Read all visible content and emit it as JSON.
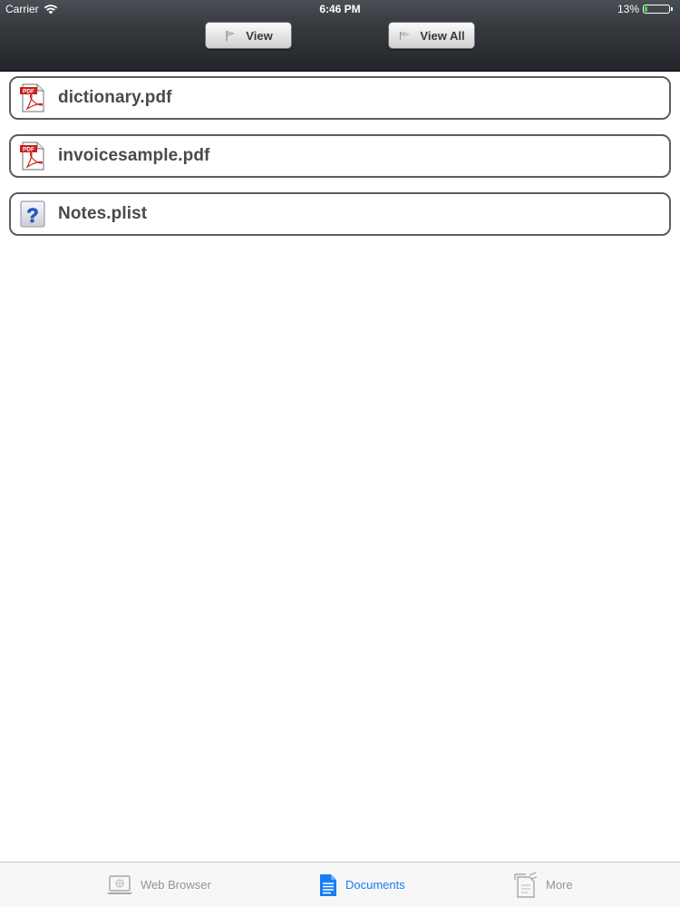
{
  "status_bar": {
    "carrier": "Carrier",
    "time": "6:46 PM",
    "battery_percent_label": "13%",
    "battery_level": 0.13,
    "wifi_icon": "wifi-icon",
    "battery_icon": "battery-icon"
  },
  "toolbar": {
    "view_label": "View",
    "view_all_label": "View All",
    "view_icon": "flag-icon",
    "view_all_icon": "double-flag-icon"
  },
  "files": [
    {
      "name": "dictionary.pdf",
      "icon": "pdf-icon"
    },
    {
      "name": "invoicesample.pdf",
      "icon": "pdf-icon"
    },
    {
      "name": "Notes.plist",
      "icon": "question-icon"
    }
  ],
  "tabbar": {
    "items": [
      {
        "label": "Web Browser",
        "icon": "laptop-icon",
        "selected": false
      },
      {
        "label": "Documents",
        "icon": "document-icon",
        "selected": true
      },
      {
        "label": "More",
        "icon": "more-icon",
        "selected": false
      }
    ],
    "selected_color": "#1a7cf4",
    "unselected_color": "#929292"
  },
  "colors": {
    "topbar": "#2e3136",
    "battery_fill": "#3fd64a",
    "row_border": "#5d5d5d",
    "pdf_red": "#c8201d"
  }
}
